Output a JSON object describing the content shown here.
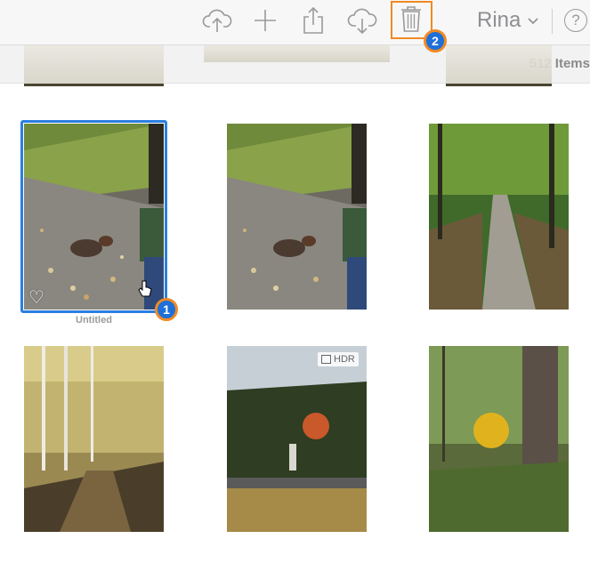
{
  "toolbar": {
    "icons": [
      "upload-icon",
      "add-icon",
      "share-icon",
      "download-icon",
      "trash-icon"
    ],
    "user_name": "Rina",
    "user_chevron": "⌄",
    "help_label": "?"
  },
  "library": {
    "item_count": "512 Items"
  },
  "photos": [
    {
      "caption": "Untitled",
      "selected": true,
      "favorite_icon": "heart-outline-icon"
    },
    {
      "caption": ""
    },
    {
      "caption": ""
    },
    {
      "caption": ""
    },
    {
      "caption": "",
      "badge": "HDR"
    },
    {
      "caption": ""
    }
  ],
  "annotations": {
    "step1": "1",
    "step2": "2"
  },
  "colors": {
    "selection": "#2b7fe0",
    "highlight": "#f08a24",
    "step_badge": "#1e6fd9"
  }
}
